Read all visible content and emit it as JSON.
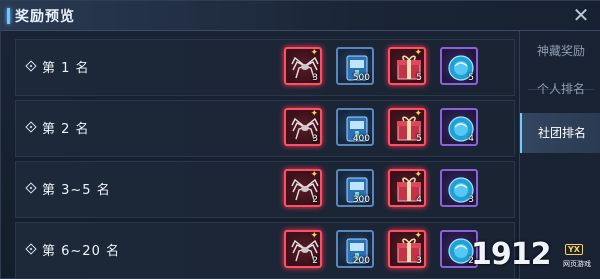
{
  "title": "奖励预览",
  "tabs": [
    {
      "label": "神藏奖励",
      "active": false
    },
    {
      "label": "个人排名",
      "active": false
    },
    {
      "label": "社团排名",
      "active": true
    }
  ],
  "rows": [
    {
      "rank": "第 1 名",
      "items": [
        {
          "icon": "spider-mech-icon",
          "color": "red",
          "count": "3"
        },
        {
          "icon": "blue-book-icon",
          "color": "blue",
          "count": "500"
        },
        {
          "icon": "gift-box-icon",
          "color": "red",
          "count": "5"
        },
        {
          "icon": "crystal-orb-icon",
          "color": "purple",
          "count": "5"
        }
      ]
    },
    {
      "rank": "第 2 名",
      "items": [
        {
          "icon": "spider-mech-icon",
          "color": "red",
          "count": "3"
        },
        {
          "icon": "blue-book-icon",
          "color": "blue",
          "count": "400"
        },
        {
          "icon": "gift-box-icon",
          "color": "red",
          "count": "5"
        },
        {
          "icon": "crystal-orb-icon",
          "color": "purple",
          "count": "4"
        }
      ]
    },
    {
      "rank": "第 3~5 名",
      "items": [
        {
          "icon": "spider-mech-icon",
          "color": "red",
          "count": "2"
        },
        {
          "icon": "blue-book-icon",
          "color": "blue",
          "count": "300"
        },
        {
          "icon": "gift-box-icon",
          "color": "red",
          "count": "4"
        },
        {
          "icon": "crystal-orb-icon",
          "color": "purple",
          "count": "3"
        }
      ]
    },
    {
      "rank": "第 6~20 名",
      "items": [
        {
          "icon": "spider-mech-icon",
          "color": "red",
          "count": "2"
        },
        {
          "icon": "blue-book-icon",
          "color": "blue",
          "count": "200"
        },
        {
          "icon": "gift-box-icon",
          "color": "red",
          "count": "3"
        },
        {
          "icon": "crystal-orb-icon",
          "color": "purple",
          "count": "2"
        }
      ]
    }
  ],
  "watermark": {
    "number": "1912",
    "badge": "YX",
    "sub": "网页游戏"
  },
  "colors": {
    "accent": "#6fc8ff",
    "rare_red": "#ff4f66",
    "epic_purple": "#8a63d9"
  }
}
